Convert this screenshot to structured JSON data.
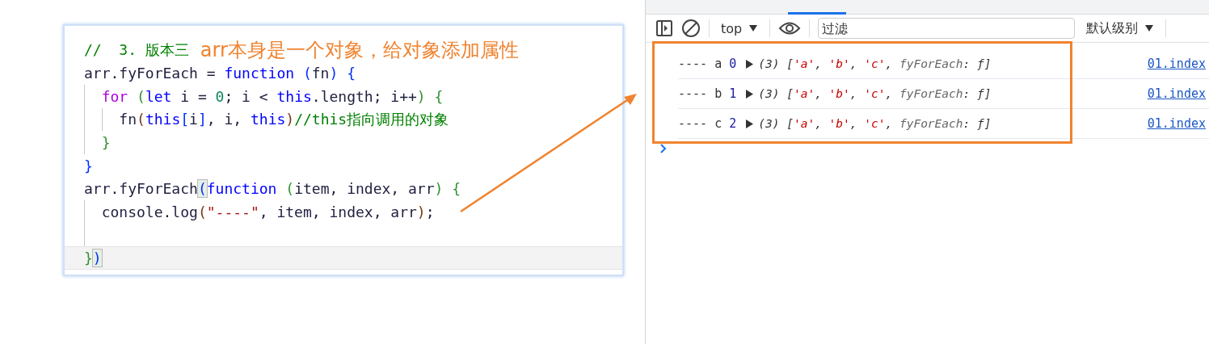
{
  "code": {
    "annotation": "arr本身是一个对象，给对象添加属性",
    "lines": [
      {
        "kind": "code",
        "current": false,
        "tokens": [
          {
            "kind": "cmt",
            "t": "//  3. 版本三"
          }
        ]
      },
      {
        "kind": "code",
        "current": false,
        "tokens": [
          {
            "kind": "id",
            "t": "arr.fyForEach = "
          },
          {
            "kind": "kw",
            "t": "function"
          },
          {
            "kind": "p1",
            "t": " ("
          },
          {
            "kind": "id",
            "t": "fn"
          },
          {
            "kind": "p1",
            "t": ") {"
          }
        ]
      },
      {
        "kind": "code",
        "current": false,
        "tokens": [
          {
            "kind": "ctrl",
            "t": "  for"
          },
          {
            "kind": "p2",
            "t": " ("
          },
          {
            "kind": "kw",
            "t": "let"
          },
          {
            "kind": "id",
            "t": " i = "
          },
          {
            "kind": "num",
            "t": "0"
          },
          {
            "kind": "id",
            "t": "; i < "
          },
          {
            "kind": "kw",
            "t": "this"
          },
          {
            "kind": "id",
            "t": ".length; i++"
          },
          {
            "kind": "p2",
            "t": ") {"
          }
        ]
      },
      {
        "kind": "code",
        "current": false,
        "tokens": [
          {
            "kind": "id",
            "t": "    fn"
          },
          {
            "kind": "p3",
            "t": "("
          },
          {
            "kind": "kw",
            "t": "this"
          },
          {
            "kind": "p1",
            "t": "["
          },
          {
            "kind": "id",
            "t": "i"
          },
          {
            "kind": "p1",
            "t": "]"
          },
          {
            "kind": "id",
            "t": ", i, "
          },
          {
            "kind": "kw",
            "t": "this"
          },
          {
            "kind": "p3",
            "t": ")"
          },
          {
            "kind": "cmt",
            "t": "//this指向调用的对象"
          }
        ]
      },
      {
        "kind": "code",
        "current": false,
        "tokens": [
          {
            "kind": "p2",
            "t": "  }"
          }
        ]
      },
      {
        "kind": "code",
        "current": false,
        "tokens": [
          {
            "kind": "p1",
            "t": "}"
          }
        ]
      },
      {
        "kind": "code",
        "current": false,
        "tokens": [
          {
            "kind": "id",
            "t": "arr.fyForEach"
          },
          {
            "kind": "match",
            "t": "("
          },
          {
            "kind": "kw",
            "t": "function"
          },
          {
            "kind": "p2",
            "t": " ("
          },
          {
            "kind": "id",
            "t": "item, index, arr"
          },
          {
            "kind": "p2",
            "t": ") {"
          }
        ]
      },
      {
        "kind": "code",
        "current": false,
        "tokens": [
          {
            "kind": "id",
            "t": "  console.log"
          },
          {
            "kind": "p3",
            "t": "("
          },
          {
            "kind": "str",
            "t": "\"----\""
          },
          {
            "kind": "id",
            "t": ", item, index, arr"
          },
          {
            "kind": "p3",
            "t": ")"
          },
          {
            "kind": "id",
            "t": ";"
          }
        ]
      },
      {
        "kind": "blank",
        "current": false
      },
      {
        "kind": "code",
        "current": true,
        "tokens": [
          {
            "kind": "p2",
            "t": "}"
          },
          {
            "kind": "match",
            "t": ")"
          }
        ]
      }
    ]
  },
  "devtools": {
    "context": "top",
    "filter": {
      "placeholder": "过滤"
    },
    "level_menu": "默认级别",
    "messages": [
      {
        "prefix": "----",
        "item": "a",
        "index": "0",
        "count": "(3)",
        "preview": [
          {
            "kind": "pl",
            "t": "["
          },
          {
            "kind": "s",
            "t": "'a'"
          },
          {
            "kind": "pl",
            "t": ", "
          },
          {
            "kind": "s",
            "t": "'b'"
          },
          {
            "kind": "pl",
            "t": ", "
          },
          {
            "kind": "s",
            "t": "'c'"
          },
          {
            "kind": "pl",
            "t": ", "
          },
          {
            "kind": "key",
            "t": "fyForEach"
          },
          {
            "kind": "pl",
            "t": ": ƒ]"
          }
        ],
        "link": "01.index"
      },
      {
        "prefix": "----",
        "item": "b",
        "index": "1",
        "count": "(3)",
        "preview": [
          {
            "kind": "pl",
            "t": "["
          },
          {
            "kind": "s",
            "t": "'a'"
          },
          {
            "kind": "pl",
            "t": ", "
          },
          {
            "kind": "s",
            "t": "'b'"
          },
          {
            "kind": "pl",
            "t": ", "
          },
          {
            "kind": "s",
            "t": "'c'"
          },
          {
            "kind": "pl",
            "t": ", "
          },
          {
            "kind": "key",
            "t": "fyForEach"
          },
          {
            "kind": "pl",
            "t": ": ƒ]"
          }
        ],
        "link": "01.index"
      },
      {
        "prefix": "----",
        "item": "c",
        "index": "2",
        "count": "(3)",
        "preview": [
          {
            "kind": "pl",
            "t": "["
          },
          {
            "kind": "s",
            "t": "'a'"
          },
          {
            "kind": "pl",
            "t": ", "
          },
          {
            "kind": "s",
            "t": "'b'"
          },
          {
            "kind": "pl",
            "t": ", "
          },
          {
            "kind": "s",
            "t": "'c'"
          },
          {
            "kind": "pl",
            "t": ", "
          },
          {
            "kind": "key",
            "t": "fyForEach"
          },
          {
            "kind": "pl",
            "t": ": ƒ]"
          }
        ],
        "link": "01.index"
      }
    ]
  }
}
